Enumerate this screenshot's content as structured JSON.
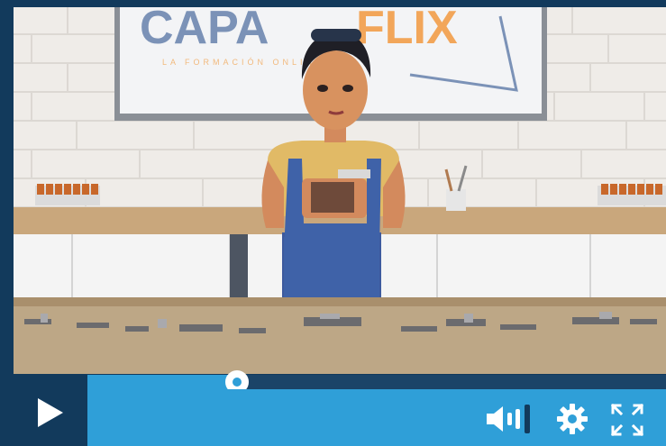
{
  "player": {
    "progress_fraction": 0.258,
    "playing": false
  },
  "video": {
    "sign_text_left": "CAPA",
    "sign_text_right": "FLIX",
    "sign_tagline": "LA FORMACIÓN ONLINE"
  },
  "controls": {
    "play_icon": "play-icon",
    "volume_icon": "volume-icon",
    "settings_icon": "gear-icon",
    "fullscreen_icon": "fullscreen-icon"
  },
  "colors": {
    "player_bg": "#123a5c",
    "accent": "#2f9fd8",
    "track": "#1b4468"
  }
}
